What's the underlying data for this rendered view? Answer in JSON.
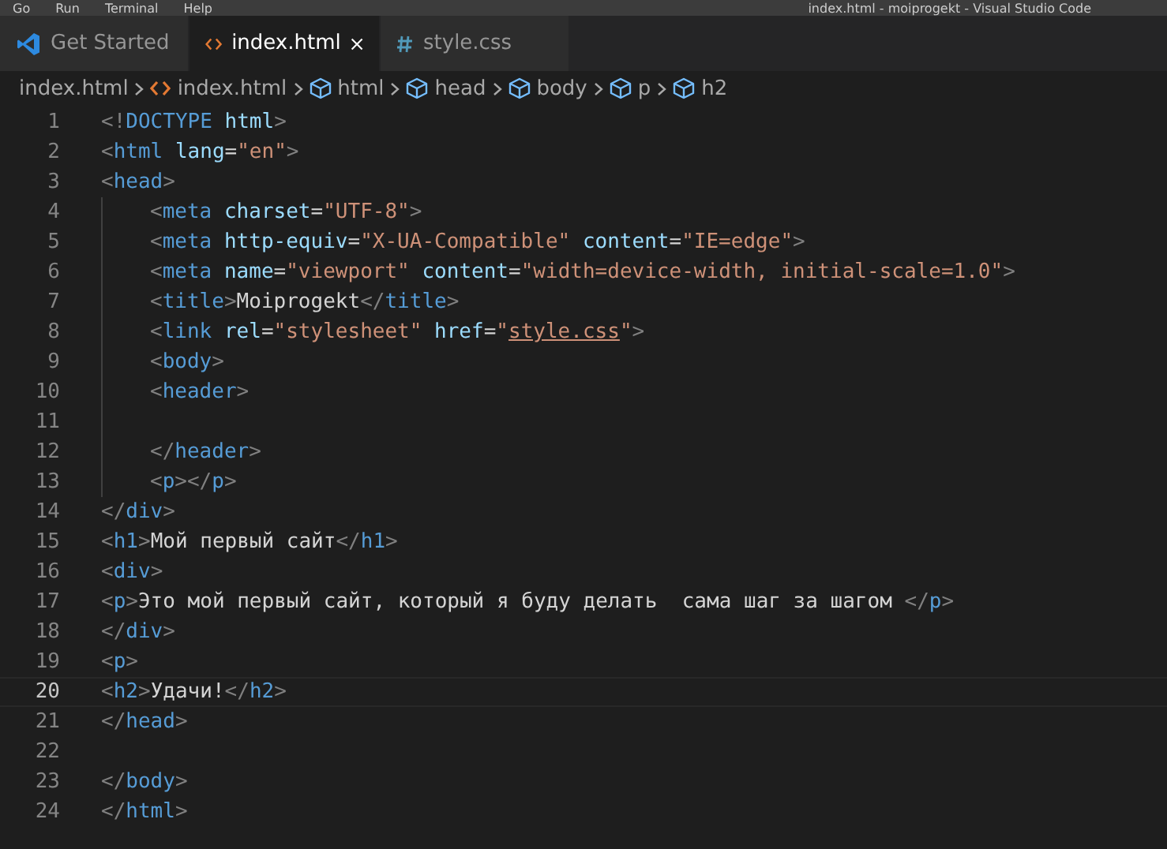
{
  "menu_bar": {
    "items": [
      "Go",
      "Run",
      "Terminal",
      "Help"
    ],
    "title": "index.html - moiprogekt - Visual Studio Code"
  },
  "tabs": [
    {
      "label": "Get Started",
      "kind": "welcome",
      "selected": false,
      "closable": false
    },
    {
      "label": "index.html",
      "kind": "html",
      "selected": true,
      "closable": true
    },
    {
      "label": "style.css",
      "kind": "css",
      "selected": false,
      "closable": false
    }
  ],
  "breadcrumbs": [
    {
      "label": "index.html",
      "kind": "path"
    },
    {
      "label": "index.html",
      "kind": "html"
    },
    {
      "label": "html",
      "kind": "element"
    },
    {
      "label": "head",
      "kind": "element"
    },
    {
      "label": "body",
      "kind": "element"
    },
    {
      "label": "p",
      "kind": "element"
    },
    {
      "label": "h2",
      "kind": "element"
    }
  ],
  "code": [
    {
      "number": "1",
      "selected": false,
      "tokens": [
        {
          "kind": "punct",
          "text": "<!"
        },
        {
          "kind": "tag",
          "text": "DOCTYPE"
        },
        {
          "kind": "attr",
          "text": " html"
        },
        {
          "kind": "punct",
          "text": ">"
        }
      ]
    },
    {
      "number": "2",
      "selected": false,
      "tokens": [
        {
          "kind": "punct",
          "text": "<"
        },
        {
          "kind": "tag",
          "text": "html"
        },
        {
          "kind": "attr",
          "text": " lang"
        },
        {
          "kind": "text",
          "text": "="
        },
        {
          "kind": "string",
          "text": "\"en\""
        },
        {
          "kind": "punct",
          "text": ">"
        }
      ]
    },
    {
      "number": "3",
      "selected": false,
      "tokens": [
        {
          "kind": "punct",
          "text": "<"
        },
        {
          "kind": "tag",
          "text": "head"
        },
        {
          "kind": "punct",
          "text": ">"
        }
      ]
    },
    {
      "children": [
        {
          "number": "4",
          "selected": false,
          "tokens": [
            {
              "kind": "punct",
              "text": "<"
            },
            {
              "kind": "tag",
              "text": "meta"
            },
            {
              "kind": "attr",
              "text": " charset"
            },
            {
              "kind": "text",
              "text": "="
            },
            {
              "kind": "string",
              "text": "\"UTF-8\""
            },
            {
              "kind": "punct",
              "text": ">"
            }
          ]
        },
        {
          "number": "5",
          "selected": false,
          "tokens": [
            {
              "kind": "punct",
              "text": "<"
            },
            {
              "kind": "tag",
              "text": "meta"
            },
            {
              "kind": "attr",
              "text": " http-equiv"
            },
            {
              "kind": "text",
              "text": "="
            },
            {
              "kind": "string",
              "text": "\"X-UA-Compatible\""
            },
            {
              "kind": "attr",
              "text": " content"
            },
            {
              "kind": "text",
              "text": "="
            },
            {
              "kind": "string",
              "text": "\"IE=edge\""
            },
            {
              "kind": "punct",
              "text": ">"
            }
          ]
        },
        {
          "number": "6",
          "selected": false,
          "tokens": [
            {
              "kind": "punct",
              "text": "<"
            },
            {
              "kind": "tag",
              "text": "meta"
            },
            {
              "kind": "attr",
              "text": " name"
            },
            {
              "kind": "text",
              "text": "="
            },
            {
              "kind": "string",
              "text": "\"viewport\""
            },
            {
              "kind": "attr",
              "text": " content"
            },
            {
              "kind": "text",
              "text": "="
            },
            {
              "kind": "string",
              "text": "\"width=device-width, initial-scale=1.0\""
            },
            {
              "kind": "punct",
              "text": ">"
            }
          ]
        },
        {
          "number": "7",
          "selected": false,
          "tokens": [
            {
              "kind": "punct",
              "text": "<"
            },
            {
              "kind": "tag",
              "text": "title"
            },
            {
              "kind": "punct",
              "text": ">"
            },
            {
              "kind": "text",
              "text": "Moiprogekt"
            },
            {
              "kind": "punct",
              "text": "</"
            },
            {
              "kind": "tag",
              "text": "title"
            },
            {
              "kind": "punct",
              "text": ">"
            }
          ]
        },
        {
          "number": "8",
          "selected": false,
          "tokens": [
            {
              "kind": "punct",
              "text": "<"
            },
            {
              "kind": "tag",
              "text": "link"
            },
            {
              "kind": "attr",
              "text": " rel"
            },
            {
              "kind": "text",
              "text": "="
            },
            {
              "kind": "string",
              "text": "\"stylesheet\""
            },
            {
              "kind": "attr",
              "text": " href"
            },
            {
              "kind": "text",
              "text": "="
            },
            {
              "kind": "string",
              "text": "\""
            },
            {
              "kind": "link",
              "text": "style.css"
            },
            {
              "kind": "string",
              "text": "\""
            },
            {
              "kind": "punct",
              "text": ">"
            }
          ]
        },
        {
          "number": "9",
          "selected": false,
          "tokens": [
            {
              "kind": "punct",
              "text": "<"
            },
            {
              "kind": "tag",
              "text": "body"
            },
            {
              "kind": "punct",
              "text": ">"
            }
          ]
        },
        {
          "number": "10",
          "selected": false,
          "tokens": [
            {
              "kind": "punct",
              "text": "<"
            },
            {
              "kind": "tag",
              "text": "header"
            },
            {
              "kind": "punct",
              "text": ">"
            }
          ]
        },
        {
          "number": "11",
          "selected": false
        },
        {
          "number": "12",
          "selected": false,
          "tokens": [
            {
              "kind": "punct",
              "text": "</"
            },
            {
              "kind": "tag",
              "text": "header"
            },
            {
              "kind": "punct",
              "text": ">"
            }
          ]
        },
        {
          "number": "13",
          "selected": false,
          "tokens": [
            {
              "kind": "punct",
              "text": "<"
            },
            {
              "kind": "tag",
              "text": "p"
            },
            {
              "kind": "punct",
              "text": "></"
            },
            {
              "kind": "tag",
              "text": "p"
            },
            {
              "kind": "punct",
              "text": ">"
            }
          ]
        }
      ]
    },
    {
      "number": "14",
      "selected": false,
      "tokens": [
        {
          "kind": "punct",
          "text": "</"
        },
        {
          "kind": "tag",
          "text": "div"
        },
        {
          "kind": "punct",
          "text": ">"
        }
      ]
    },
    {
      "number": "15",
      "selected": false,
      "tokens": [
        {
          "kind": "punct",
          "text": "<"
        },
        {
          "kind": "tag",
          "text": "h1"
        },
        {
          "kind": "punct",
          "text": ">"
        },
        {
          "kind": "text",
          "text": "Мой первый сайт"
        },
        {
          "kind": "punct",
          "text": "</"
        },
        {
          "kind": "tag",
          "text": "h1"
        },
        {
          "kind": "punct",
          "text": ">"
        }
      ]
    },
    {
      "number": "16",
      "selected": false,
      "tokens": [
        {
          "kind": "punct",
          "text": "<"
        },
        {
          "kind": "tag",
          "text": "div"
        },
        {
          "kind": "punct",
          "text": ">"
        }
      ]
    },
    {
      "number": "17",
      "selected": false,
      "tokens": [
        {
          "kind": "punct",
          "text": "<"
        },
        {
          "kind": "tag",
          "text": "p"
        },
        {
          "kind": "punct",
          "text": ">"
        },
        {
          "kind": "text",
          "text": "Это мой первый сайт, который я буду делать  сама шаг за шагом "
        },
        {
          "kind": "punct",
          "text": "</"
        },
        {
          "kind": "tag",
          "text": "p"
        },
        {
          "kind": "punct",
          "text": ">"
        }
      ]
    },
    {
      "number": "18",
      "selected": false,
      "tokens": [
        {
          "kind": "punct",
          "text": "</"
        },
        {
          "kind": "tag",
          "text": "div"
        },
        {
          "kind": "punct",
          "text": ">"
        }
      ]
    },
    {
      "number": "19",
      "selected": false,
      "tokens": [
        {
          "kind": "punct",
          "text": "<"
        },
        {
          "kind": "tag",
          "text": "p"
        },
        {
          "kind": "punct",
          "text": ">"
        }
      ]
    },
    {
      "number": "20",
      "selected": true,
      "tokens": [
        {
          "kind": "punct",
          "text": "<"
        },
        {
          "kind": "tag",
          "text": "h2"
        },
        {
          "kind": "punct",
          "text": ">"
        },
        {
          "kind": "text",
          "text": "Удачи!"
        },
        {
          "kind": "punct",
          "text": "</"
        },
        {
          "kind": "tag",
          "text": "h2"
        },
        {
          "kind": "punct",
          "text": ">"
        }
      ]
    },
    {
      "number": "21",
      "selected": false,
      "tokens": [
        {
          "kind": "punct",
          "text": "</"
        },
        {
          "kind": "tag",
          "text": "head"
        },
        {
          "kind": "punct",
          "text": ">"
        }
      ]
    },
    {
      "number": "22",
      "selected": false
    },
    {
      "number": "23",
      "selected": false,
      "tokens": [
        {
          "kind": "punct",
          "text": "</"
        },
        {
          "kind": "tag",
          "text": "body"
        },
        {
          "kind": "punct",
          "text": ">"
        }
      ]
    },
    {
      "number": "24",
      "selected": false,
      "tokens": [
        {
          "kind": "punct",
          "text": "</"
        },
        {
          "kind": "tag",
          "text": "html"
        },
        {
          "kind": "punct",
          "text": ">"
        }
      ]
    }
  ]
}
